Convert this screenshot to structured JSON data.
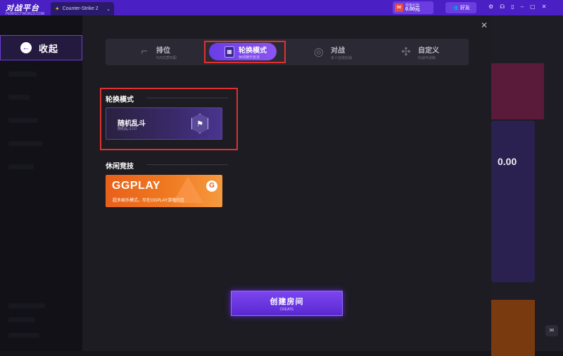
{
  "titlebar": {
    "logo_text": "对战平台",
    "logo_sub": "PERFECTWORLD.COM",
    "game_tab": "Counter-Strike 2",
    "promo_label": "现金红包",
    "promo_amount": "0.00元",
    "friends_label": "好友",
    "icons": [
      "settings-icon",
      "headset-icon",
      "phone-icon",
      "minimize-icon",
      "restore-icon",
      "close-icon"
    ]
  },
  "sidebar": {
    "collapse_label": "收起"
  },
  "modal": {
    "tabs": [
      {
        "label": "排位",
        "sub": "5V5优质匹配"
      },
      {
        "label": "轮换模式",
        "sub": "休闲娱乐玩法"
      },
      {
        "label": "对战",
        "sub": "多人在线对战"
      },
      {
        "label": "自定义",
        "sub": "约战与训练"
      }
    ],
    "active_tab": 1,
    "sections": [
      {
        "title": "轮换模式",
        "card": {
          "name": "随机乱斗",
          "sub": "随机乱斗3.0"
        }
      },
      {
        "title": "休闲竞技",
        "card": {
          "logo": "GGPLAY",
          "sub": "超多娱乐模式，尽在GGPLAY游戏社区"
        }
      }
    ],
    "create_button": {
      "label": "创建房间",
      "sub": "CREATE"
    }
  },
  "right_panel": {
    "value": "0.00"
  },
  "colors": {
    "accent": "#6a3ce8",
    "titlebar": "#4a1fc4",
    "highlight": "#e03030",
    "ggplay": "#f07a22"
  }
}
